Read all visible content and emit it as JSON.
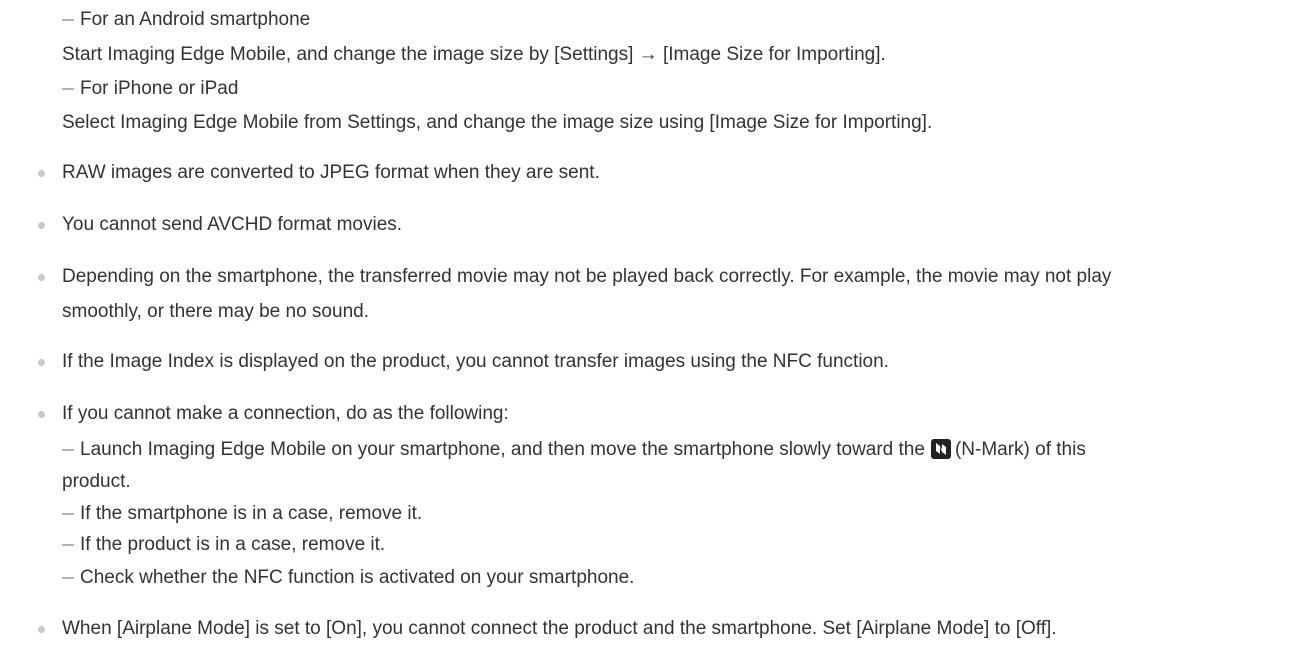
{
  "sub_items_top": [
    "For an Android smartphone",
    "For iPhone or iPad"
  ],
  "sub_details_top": [
    "Start Imaging Edge Mobile, and change the image size by [Settings] → [Image Size for Importing].",
    "Select Imaging Edge Mobile from Settings, and change the image size using [Image Size for Importing]."
  ],
  "notes": [
    "RAW images are converted to JPEG format when they are sent.",
    "You cannot send AVCHD format movies.",
    "Depending on the smartphone, the transferred movie may not be played back correctly. For example, the movie may not play",
    "smoothly, or there may be no sound.",
    "If the Image Index is displayed on the product, you cannot transfer images using the NFC function.",
    "If you cannot make a connection, do as the following:"
  ],
  "connection_tips": {
    "first_prefix": "Launch Imaging Edge Mobile on your smartphone, and then move the smartphone slowly toward the",
    "first_suffix": "(N-Mark) of this",
    "first_continued": "product.",
    "others": [
      "If the smartphone is in a case, remove it.",
      "If the product is in a case, remove it.",
      "Check whether the NFC function is activated on your smartphone."
    ]
  },
  "last_note": "When [Airplane Mode] is set to [On], you cannot connect the product and the smartphone. Set [Airplane Mode] to [Off].",
  "icons": {
    "nfc": "n-mark-icon"
  },
  "colors": {
    "text": "#333333",
    "bullet": "#c8c8c8",
    "dash": "#b3b3b3"
  }
}
